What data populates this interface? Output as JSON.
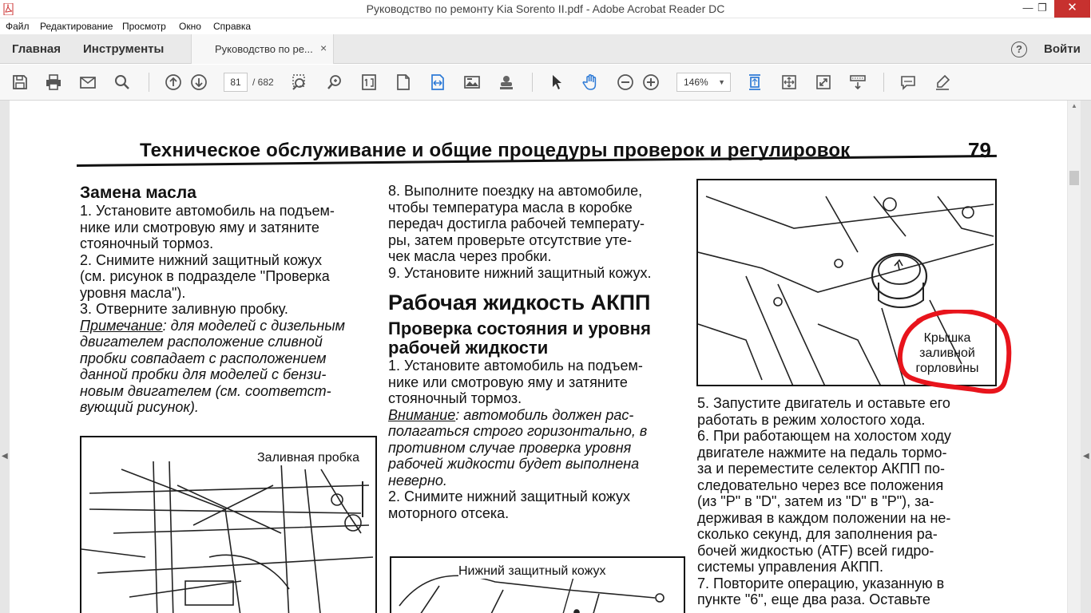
{
  "window": {
    "title": "Руководство по ремонту Kia Sorento II.pdf - Adobe Acrobat Reader DC",
    "min_label": "—",
    "max_label": "❐",
    "close_label": "✕"
  },
  "menu": [
    "Файл",
    "Редактирование",
    "Просмотр",
    "Окно",
    "Справка"
  ],
  "tabs": {
    "home": "Главная",
    "tools": "Инструменты",
    "document": "Руководство по ре...",
    "close": "×",
    "help": "?",
    "signin": "Войти"
  },
  "toolbar": {
    "current_page": "81",
    "total_pages": "/ 682",
    "zoom": "146%",
    "zoom_caret": "▼",
    "icons": [
      "save-icon",
      "print-icon",
      "email-icon",
      "search-icon",
      "page-up-icon",
      "page-down-icon",
      "select-zoom-icon",
      "zoom-marquee-icon",
      "single-page-icon",
      "scroll-page-icon",
      "fit-width-icon",
      "image-export-icon",
      "stamp-icon",
      "cursor-icon",
      "hand-icon",
      "zoom-out-icon",
      "zoom-in-icon",
      "rotate-fit-icon",
      "fit-page-icon",
      "fullscreen-icon",
      "reading-mode-icon",
      "comment-icon",
      "highlight-icon"
    ]
  },
  "document": {
    "header": "Техническое обслуживание и общие процедуры проверок и регулировок",
    "page_number": "79",
    "left": {
      "heading": "Замена масла",
      "s1": "1. Установите автомобиль на подъем-",
      "s1b": "нике или смотровую яму и затяните",
      "s1c": "стояночный тормоз.",
      "s2": "2. Снимите нижний защитный кожух",
      "s2b": "(см. рисунок в подразделе \"Проверка",
      "s2c": "уровня масла\").",
      "s3": "3. Отверните заливную пробку.",
      "note_label": "Примечание",
      "note1": ": для моделей с дизельным",
      "note2": "двигателем расположение сливной",
      "note3": "пробки совпадает с расположением",
      "note4": "данной пробки для моделей с бензи-",
      "note5": "новым двигателем (см. соответст-",
      "note6": "вующий рисунок).",
      "figure_label": "Заливная пробка"
    },
    "middle": {
      "s8a": "8. Выполните поездку на автомобиле,",
      "s8b": "чтобы температура масла в коробке",
      "s8c": "передач достигла рабочей температу-",
      "s8d": "ры, затем проверьте отсутствие уте-",
      "s8e": "чек масла через пробки.",
      "s9": "9. Установите нижний защитный кожух.",
      "title": "Рабочая жидкость АКПП",
      "subtitle1": "Проверка состояния и уровня",
      "subtitle2": "рабочей жидкости",
      "p1a": "1. Установите автомобиль на подъем-",
      "p1b": "нике или смотровую яму и затяните",
      "p1c": "стояночный тормоз.",
      "warn_label": "Внимание",
      "warn1": ": автомобиль должен рас-",
      "warn2": "полагаться строго горизонтально, в",
      "warn3": "противном случае проверка уровня",
      "warn4": "рабочей жидкости будет выполнена",
      "warn5": "неверно.",
      "p2a": "2. Снимите нижний защитный кожух",
      "p2b": "моторного отсека.",
      "figure_label": "Нижний защитный кожух"
    },
    "right": {
      "callout1": "Крышка",
      "callout2": "заливной",
      "callout3": "горловины",
      "p5a": "5. Запустите двигатель и оставьте его",
      "p5b": "работать в режим холостого хода.",
      "p6a": "6. При работающем на холостом ходу",
      "p6b": "двигателе нажмите на педаль тормо-",
      "p6c": "за и переместите селектор АКПП по-",
      "p6d": "следовательно через все положения",
      "p6e": "(из \"P\" в \"D\", затем из \"D\" в \"P\"), за-",
      "p6f": "держивая в каждом положении на не-",
      "p6g": "сколько секунд, для заполнения ра-",
      "p6h": "бочей жидкостью (ATF) всей гидро-",
      "p6i": "системы управления АКПП.",
      "p7a": "7. Повторите операцию, указанную в",
      "p7b": "пункте \"6\", еще два раза. Оставьте"
    }
  },
  "colors": {
    "close": "#c7312f",
    "blue_icon": "#2d7ad6",
    "red_circle": "#e8141c"
  }
}
